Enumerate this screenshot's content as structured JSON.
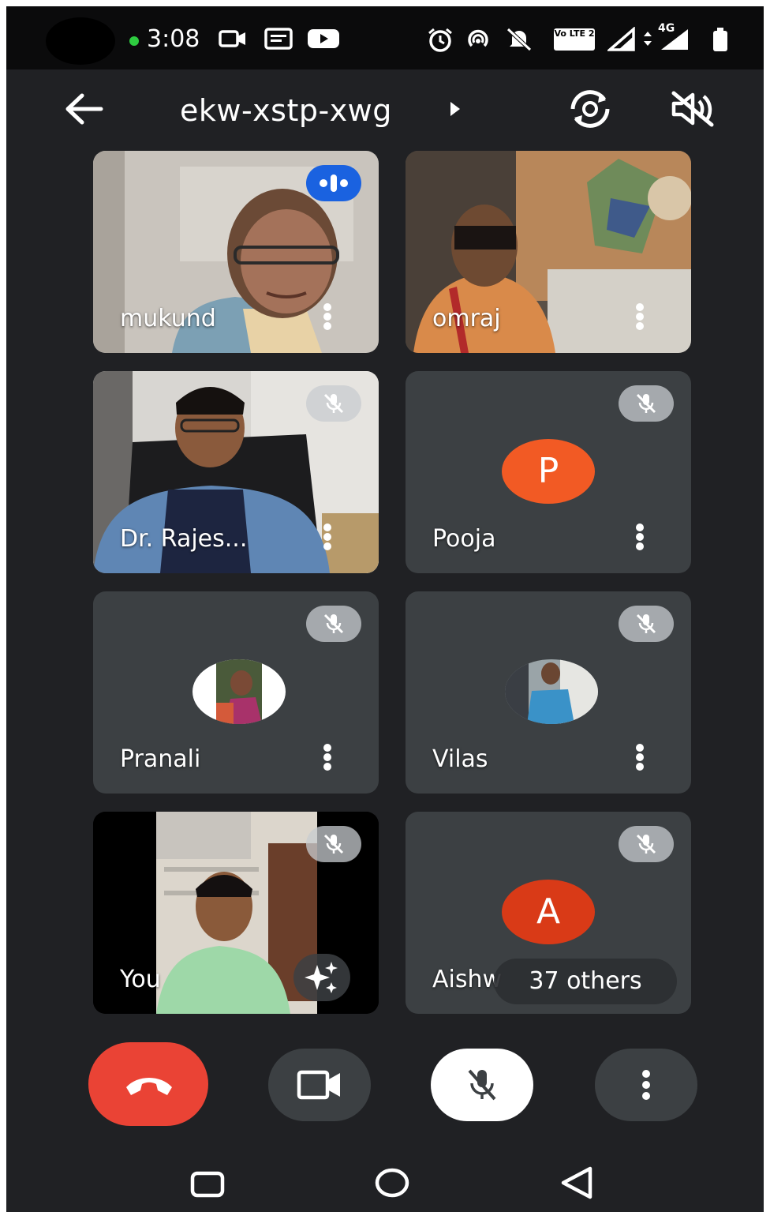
{
  "status_bar": {
    "time": "3:08",
    "icons": [
      "camera-icon",
      "notes-icon",
      "youtube-icon",
      "alarm-icon",
      "hotspot-icon",
      "mute-bell-icon",
      "volte-icon",
      "signal-icon",
      "data-arrows-icon",
      "signal-4g-icon",
      "battery-icon"
    ],
    "volte_label": "Vo LTE 2",
    "network_label": "4G"
  },
  "top_bar": {
    "meeting_code": "ekw-xstp-xwg"
  },
  "tiles": [
    {
      "name": "mukund",
      "state": "speaking"
    },
    {
      "name": "omraj",
      "state": "video"
    },
    {
      "name": "Dr. Rajes...",
      "state": "muted"
    },
    {
      "name": "Pooja",
      "state": "muted",
      "initial": "P",
      "avatar_color": "#f25a24"
    },
    {
      "name": "Pranali",
      "state": "muted"
    },
    {
      "name": "Vilas",
      "state": "muted"
    },
    {
      "name": "You",
      "state": "muted"
    },
    {
      "name": "Aishw",
      "state": "muted",
      "initial": "A",
      "avatar_color": "#d93a17",
      "others_label": "37 others"
    }
  ],
  "controls": [
    "end-call",
    "camera",
    "microphone-muted",
    "more-options"
  ],
  "colors": {
    "background": "#202124",
    "tile": "#3c4043",
    "end_call": "#ea4335",
    "speaking": "#1a62e0"
  }
}
